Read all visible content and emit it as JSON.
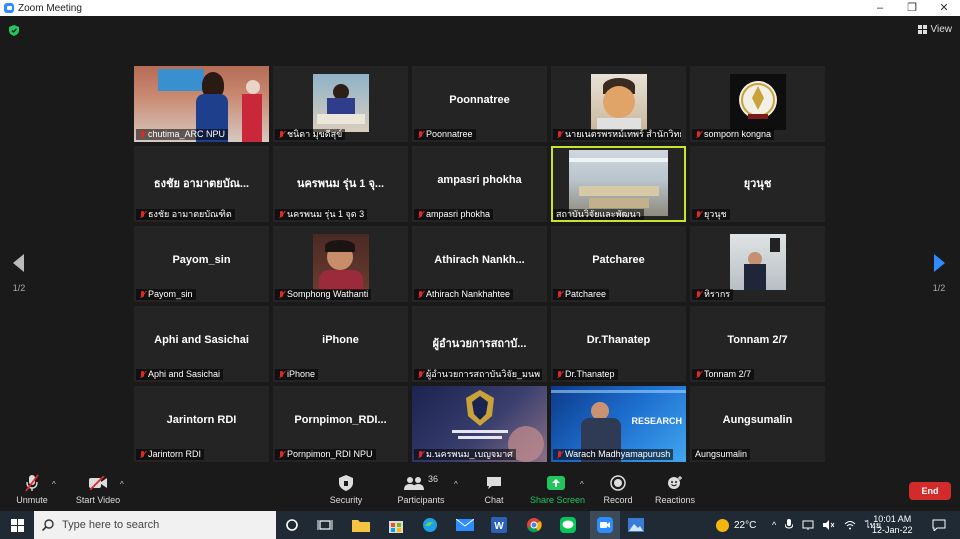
{
  "window": {
    "title": "Zoom Meeting",
    "controls": [
      "–",
      "❐",
      "✕"
    ]
  },
  "view": {
    "label": "View"
  },
  "pagination": {
    "left": "1/2",
    "right": "1/2"
  },
  "tiles": [
    {
      "display": "",
      "label": "chutima_ARC NPU",
      "video": "classroom"
    },
    {
      "display": "",
      "label": "ชนิดา มุขดีสุข์",
      "video": "desk"
    },
    {
      "display": "Poonnatree",
      "label": "Poonnatree"
    },
    {
      "display": "",
      "label": "นายเนตรพรหม์เทพร์ สำนักวิทยบ...",
      "video": "face"
    },
    {
      "display": "",
      "label": "somporn kongna",
      "video": "logo"
    },
    {
      "display": "ธงชัย อามาตยบัณ...",
      "label": "ธงชัย อามาตยบัณฑิต"
    },
    {
      "display": "นครพนม รุ่น 1 จุ...",
      "label": "นครพนม รุ่น 1 จุด 3"
    },
    {
      "display": "ampasri phokha",
      "label": "ampasri phokha"
    },
    {
      "display": "",
      "label": "สถาบันวิจัยและพัฒนา",
      "video": "room",
      "active": true
    },
    {
      "display": "ยุวนุช",
      "label": "ยุวนุช"
    },
    {
      "display": "Payom_sin",
      "label": "Payom_sin"
    },
    {
      "display": "",
      "label": "Somphong Wathanti",
      "video": "person"
    },
    {
      "display": "Athirach  Nankh...",
      "label": "Athirach Nankhahtee"
    },
    {
      "display": "Patcharee",
      "label": "Patcharee"
    },
    {
      "display": "",
      "label": "หิรากร",
      "video": "speaker"
    },
    {
      "display": "Aphi and Sasichai",
      "label": "Aphi and Sasichai"
    },
    {
      "display": "iPhone",
      "label": "iPhone"
    },
    {
      "display": "ผู้อำนวยการสถาบั...",
      "label": "ผู้อำนวยการสถาบันวิจัย_มนพ"
    },
    {
      "display": "Dr.Thanatep",
      "label": "Dr.Thanatep"
    },
    {
      "display": "Tonnam 2/7",
      "label": "Tonnam 2/7"
    },
    {
      "display": "Jarintorn RDI",
      "label": "Jarintorn RDI"
    },
    {
      "display": "Pornpimon_RDI...",
      "label": "Pornpimon_RDI NPU"
    },
    {
      "display": "",
      "label": "ม.นครพนม_เบญจมาศ",
      "video": "slide"
    },
    {
      "display": "",
      "label": "Warach Madhyamapurush",
      "video": "research",
      "overlay": "RESEARCH"
    },
    {
      "display": "Aungsumalin",
      "label": "Aungsumalin",
      "muted": false
    }
  ],
  "toolbar": {
    "unmute": "Unmute",
    "start_video": "Start Video",
    "security": "Security",
    "participants": "Participants",
    "participants_count": "36",
    "chat": "Chat",
    "share_screen": "Share Screen",
    "record": "Record",
    "reactions": "Reactions",
    "end": "End"
  },
  "taskbar": {
    "search_placeholder": "Type here to search",
    "temperature": "22°C",
    "language": "ไทย",
    "time": "10:01 AM",
    "date": "12-Jan-22"
  },
  "colors": {
    "active_border": "#c9e52a",
    "end_button": "#d12b2b",
    "share_green": "#22c55e",
    "zoom_blue": "#2d8cff"
  }
}
